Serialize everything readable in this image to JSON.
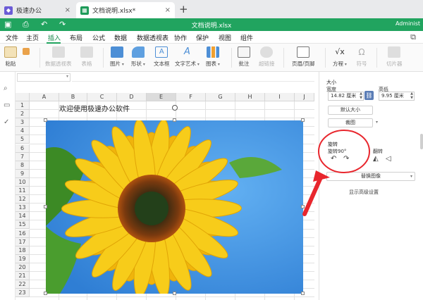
{
  "browser_tabs": [
    {
      "label": "极速办公"
    },
    {
      "label": "文档说明.xlsx*"
    }
  ],
  "titlebar": {
    "title": "文档说明.xlsx",
    "user": "Administ"
  },
  "menu": {
    "items": [
      "文件",
      "主页",
      "插入",
      "布局",
      "公式",
      "数据",
      "数据透视表",
      "协作",
      "保护",
      "视图",
      "组件"
    ],
    "active": "插入"
  },
  "ribbon": {
    "paste": "粘贴",
    "pivot_table": "数据透视表",
    "table": "表格",
    "picture": "图片",
    "shape": "形状",
    "textbox": "文本框",
    "textart": "文字艺术",
    "chart": "图表",
    "comment": "批注",
    "hyperlink": "超链接",
    "header_footer": "页眉/页脚",
    "equation": "方程",
    "symbol": "符号",
    "slicer": "切片器"
  },
  "sheet": {
    "columns": [
      "A",
      "B",
      "C",
      "D",
      "E",
      "F",
      "G",
      "H",
      "I",
      "J"
    ],
    "selected_column": "E",
    "rows": [
      "1",
      "2",
      "3",
      "4",
      "5",
      "6",
      "7",
      "8",
      "9",
      "10",
      "11",
      "12",
      "13",
      "14",
      "15",
      "16",
      "17",
      "18",
      "19",
      "20",
      "21",
      "22",
      "23"
    ],
    "cell_b1_text": "欢迎使用极速办公软件"
  },
  "panel": {
    "size_title": "大小",
    "width_label": "宽度",
    "height_label": "高低",
    "width_value": "14.82 厘米",
    "height_value": "9.95 厘米",
    "default_size": "默认大小",
    "crop": "裁图",
    "rotate_title": "旋转",
    "rotate_90": "旋转90°",
    "flip": "翻转",
    "replace_image": "替换图像",
    "show_advanced": "显示高级设置"
  },
  "colors": {
    "accent_green": "#21a45f",
    "annotation_red": "#e8262d",
    "sky_blue": "#3f8fe2"
  }
}
